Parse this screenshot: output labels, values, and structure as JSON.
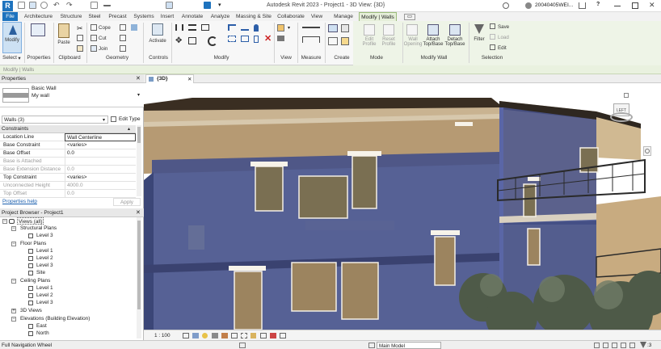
{
  "app": {
    "title": "Autodesk Revit 2023 - Project1 - 3D View: {3D}",
    "user": "20040405WEI...",
    "help_icon": "?"
  },
  "tabs": [
    {
      "label": "File"
    },
    {
      "label": "Architecture"
    },
    {
      "label": "Structure"
    },
    {
      "label": "Steel"
    },
    {
      "label": "Precast"
    },
    {
      "label": "Systems"
    },
    {
      "label": "Insert"
    },
    {
      "label": "Annotate"
    },
    {
      "label": "Analyze"
    },
    {
      "label": "Massing & Site"
    },
    {
      "label": "Collaborate"
    },
    {
      "label": "View"
    },
    {
      "label": "Manage"
    },
    {
      "label": "Modify | Walls"
    }
  ],
  "ribbon": {
    "modify": "Modify",
    "select": "Select",
    "paste": "Paste",
    "cope": "Cope",
    "cut": "Cut",
    "join": "Join",
    "activate": "Activate",
    "edit_profile": "Edit Profile",
    "reset_profile": "Reset Profile",
    "wall_opening": "Wall Opening",
    "attach_top_base": "Attach Top/Base",
    "detach_top_base": "Detach Top/Base",
    "filter": "Filter",
    "save": "Save",
    "load": "Load",
    "edit": "Edit",
    "groups": {
      "select": "Select",
      "properties": "Properties",
      "clipboard": "Clipboard",
      "geometry": "Geometry",
      "controls": "Controls",
      "modify": "Modify",
      "view": "View",
      "measure": "Measure",
      "create": "Create",
      "mode": "Mode",
      "modify_wall": "Modify Wall",
      "selection": "Selection"
    }
  },
  "options_bar": "Modify | Walls",
  "properties": {
    "header": "Properties",
    "type_family": "Basic Wall",
    "type_name": "My wall",
    "instance_count": "Walls (3)",
    "edit_type": "Edit Type",
    "section": "Constraints",
    "rows": [
      {
        "key": "Location Line",
        "value": "Wall Centerline"
      },
      {
        "key": "Base Constraint",
        "value": "<varies>"
      },
      {
        "key": "Base Offset",
        "value": "0.0"
      },
      {
        "key": "Base is Attached",
        "value": ""
      },
      {
        "key": "Base Extension Distance",
        "value": "0.0"
      },
      {
        "key": "Top Constraint",
        "value": "<varies>"
      },
      {
        "key": "Unconnected Height",
        "value": "4000.0"
      },
      {
        "key": "Top Offset",
        "value": "0.0"
      }
    ],
    "help": "Properties help",
    "apply": "Apply"
  },
  "browser": {
    "header": "Project Browser - Project1",
    "nodes": [
      {
        "label": "Views (all)"
      },
      {
        "label": "Structural Plans"
      },
      {
        "label": "Level 3"
      },
      {
        "label": "Floor Plans"
      },
      {
        "label": "Level 1"
      },
      {
        "label": "Level 2"
      },
      {
        "label": "Level 3"
      },
      {
        "label": "Site"
      },
      {
        "label": "Ceiling Plans"
      },
      {
        "label": "Level 1"
      },
      {
        "label": "Level 2"
      },
      {
        "label": "Level 3"
      },
      {
        "label": "3D Views"
      },
      {
        "label": "Elevations (Building Elevation)"
      },
      {
        "label": "East"
      },
      {
        "label": "North"
      }
    ]
  },
  "view": {
    "tab": "{3D}",
    "scale": "1 : 100",
    "viewcube": "LEFT"
  },
  "status": {
    "left": "Full Navigation Wheel",
    "model": "Main Model",
    "filter_count": ":3"
  }
}
